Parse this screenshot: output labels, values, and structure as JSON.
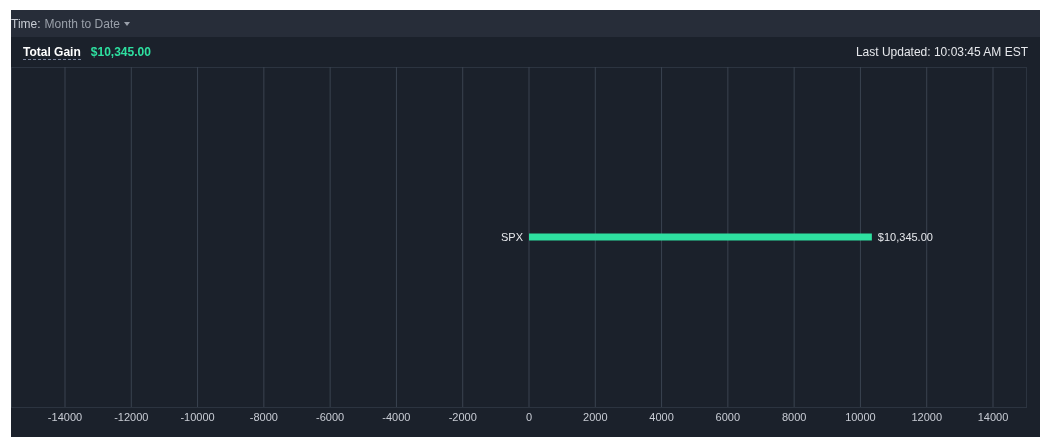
{
  "toolbar": {
    "label": "Time:",
    "value": "Month to Date"
  },
  "summary": {
    "label": "Total Gain",
    "value": "$10,345.00",
    "last_updated": "Last Updated: 10:03:45 AM EST"
  },
  "chart_data": {
    "type": "bar",
    "orientation": "horizontal",
    "categories": [
      "SPX"
    ],
    "series": [
      {
        "color": "#2ee0a0",
        "values": [
          10345
        ]
      }
    ],
    "grid": true,
    "xlim": [
      -14000,
      14000
    ],
    "xticks": [
      -14000,
      -12000,
      -10000,
      -8000,
      -6000,
      -4000,
      -2000,
      0,
      2000,
      4000,
      6000,
      8000,
      10000,
      12000,
      14000
    ],
    "value_labels": [
      "$10,345.00"
    ]
  }
}
